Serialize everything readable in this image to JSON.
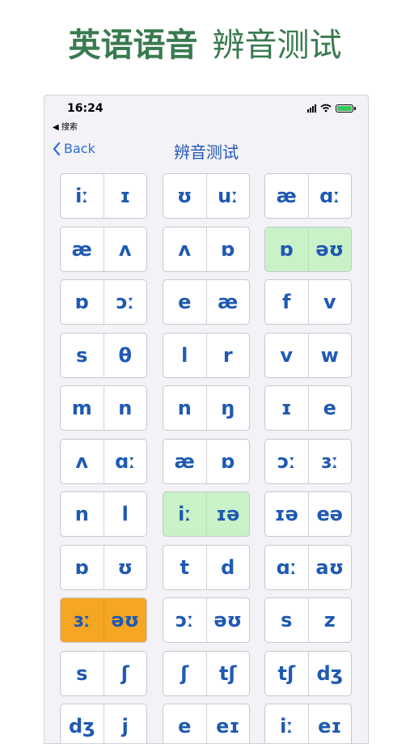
{
  "headline": {
    "bold": "英语语音",
    "light": "辨音测试"
  },
  "status_bar": {
    "time": "16:24",
    "back_app": "◀ 搜索"
  },
  "nav": {
    "back_label": "Back",
    "title": "辨音测试"
  },
  "colors": {
    "accent": "#2d6fd6",
    "phoneme": "#1f59b3",
    "headline": "#3a7a4f",
    "correct": "#c9f2c9",
    "selected": "#f5a623"
  },
  "pairs": [
    {
      "left": "iː",
      "right": "ɪ",
      "state": "normal"
    },
    {
      "left": "ʊ",
      "right": "uː",
      "state": "normal"
    },
    {
      "left": "æ",
      "right": "ɑː",
      "state": "normal"
    },
    {
      "left": "æ",
      "right": "ʌ",
      "state": "normal"
    },
    {
      "left": "ʌ",
      "right": "ɒ",
      "state": "normal"
    },
    {
      "left": "ɒ",
      "right": "əʊ",
      "state": "correct"
    },
    {
      "left": "ɒ",
      "right": "ɔː",
      "state": "normal"
    },
    {
      "left": "e",
      "right": "æ",
      "state": "normal"
    },
    {
      "left": "f",
      "right": "v",
      "state": "normal"
    },
    {
      "left": "s",
      "right": "θ",
      "state": "normal"
    },
    {
      "left": "l",
      "right": "r",
      "state": "normal"
    },
    {
      "left": "v",
      "right": "w",
      "state": "normal"
    },
    {
      "left": "m",
      "right": "n",
      "state": "normal"
    },
    {
      "left": "n",
      "right": "ŋ",
      "state": "normal"
    },
    {
      "left": "ɪ",
      "right": "e",
      "state": "normal"
    },
    {
      "left": "ʌ",
      "right": "ɑː",
      "state": "normal"
    },
    {
      "left": "æ",
      "right": "ɒ",
      "state": "normal"
    },
    {
      "left": "ɔː",
      "right": "ɜː",
      "state": "normal"
    },
    {
      "left": "n",
      "right": "l",
      "state": "normal"
    },
    {
      "left": "iː",
      "right": "ɪə",
      "state": "correct"
    },
    {
      "left": "ɪə",
      "right": "eə",
      "state": "normal"
    },
    {
      "left": "ɒ",
      "right": "ʊ",
      "state": "normal"
    },
    {
      "left": "t",
      "right": "d",
      "state": "normal"
    },
    {
      "left": "ɑː",
      "right": "aʊ",
      "state": "normal"
    },
    {
      "left": "ɜː",
      "right": "əʊ",
      "state": "selected"
    },
    {
      "left": "ɔː",
      "right": "əʊ",
      "state": "normal"
    },
    {
      "left": "s",
      "right": "z",
      "state": "normal"
    },
    {
      "left": "s",
      "right": "ʃ",
      "state": "normal"
    },
    {
      "left": "ʃ",
      "right": "tʃ",
      "state": "normal"
    },
    {
      "left": "tʃ",
      "right": "dʒ",
      "state": "normal"
    },
    {
      "left": "dʒ",
      "right": "j",
      "state": "normal"
    },
    {
      "left": "e",
      "right": "eɪ",
      "state": "normal"
    },
    {
      "left": "iː",
      "right": "eɪ",
      "state": "normal"
    }
  ]
}
